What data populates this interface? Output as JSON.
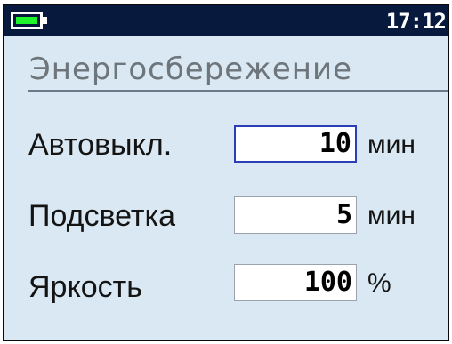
{
  "status_bar": {
    "battery_icon": "battery-icon",
    "battery_fill_color": "#1ff52b",
    "time": "17:12"
  },
  "title": "Энергосбережение",
  "settings": [
    {
      "label": "Автовыкл.",
      "value": "10",
      "unit": "мин",
      "active": true
    },
    {
      "label": "Подсветка",
      "value": "5",
      "unit": "мин",
      "active": false
    },
    {
      "label": "Яркость",
      "value": "100",
      "unit": "%",
      "active": false
    }
  ],
  "colors": {
    "background": "#d9e8f2",
    "status_bar": "#071a3d",
    "active_border": "#2a3fb5"
  }
}
